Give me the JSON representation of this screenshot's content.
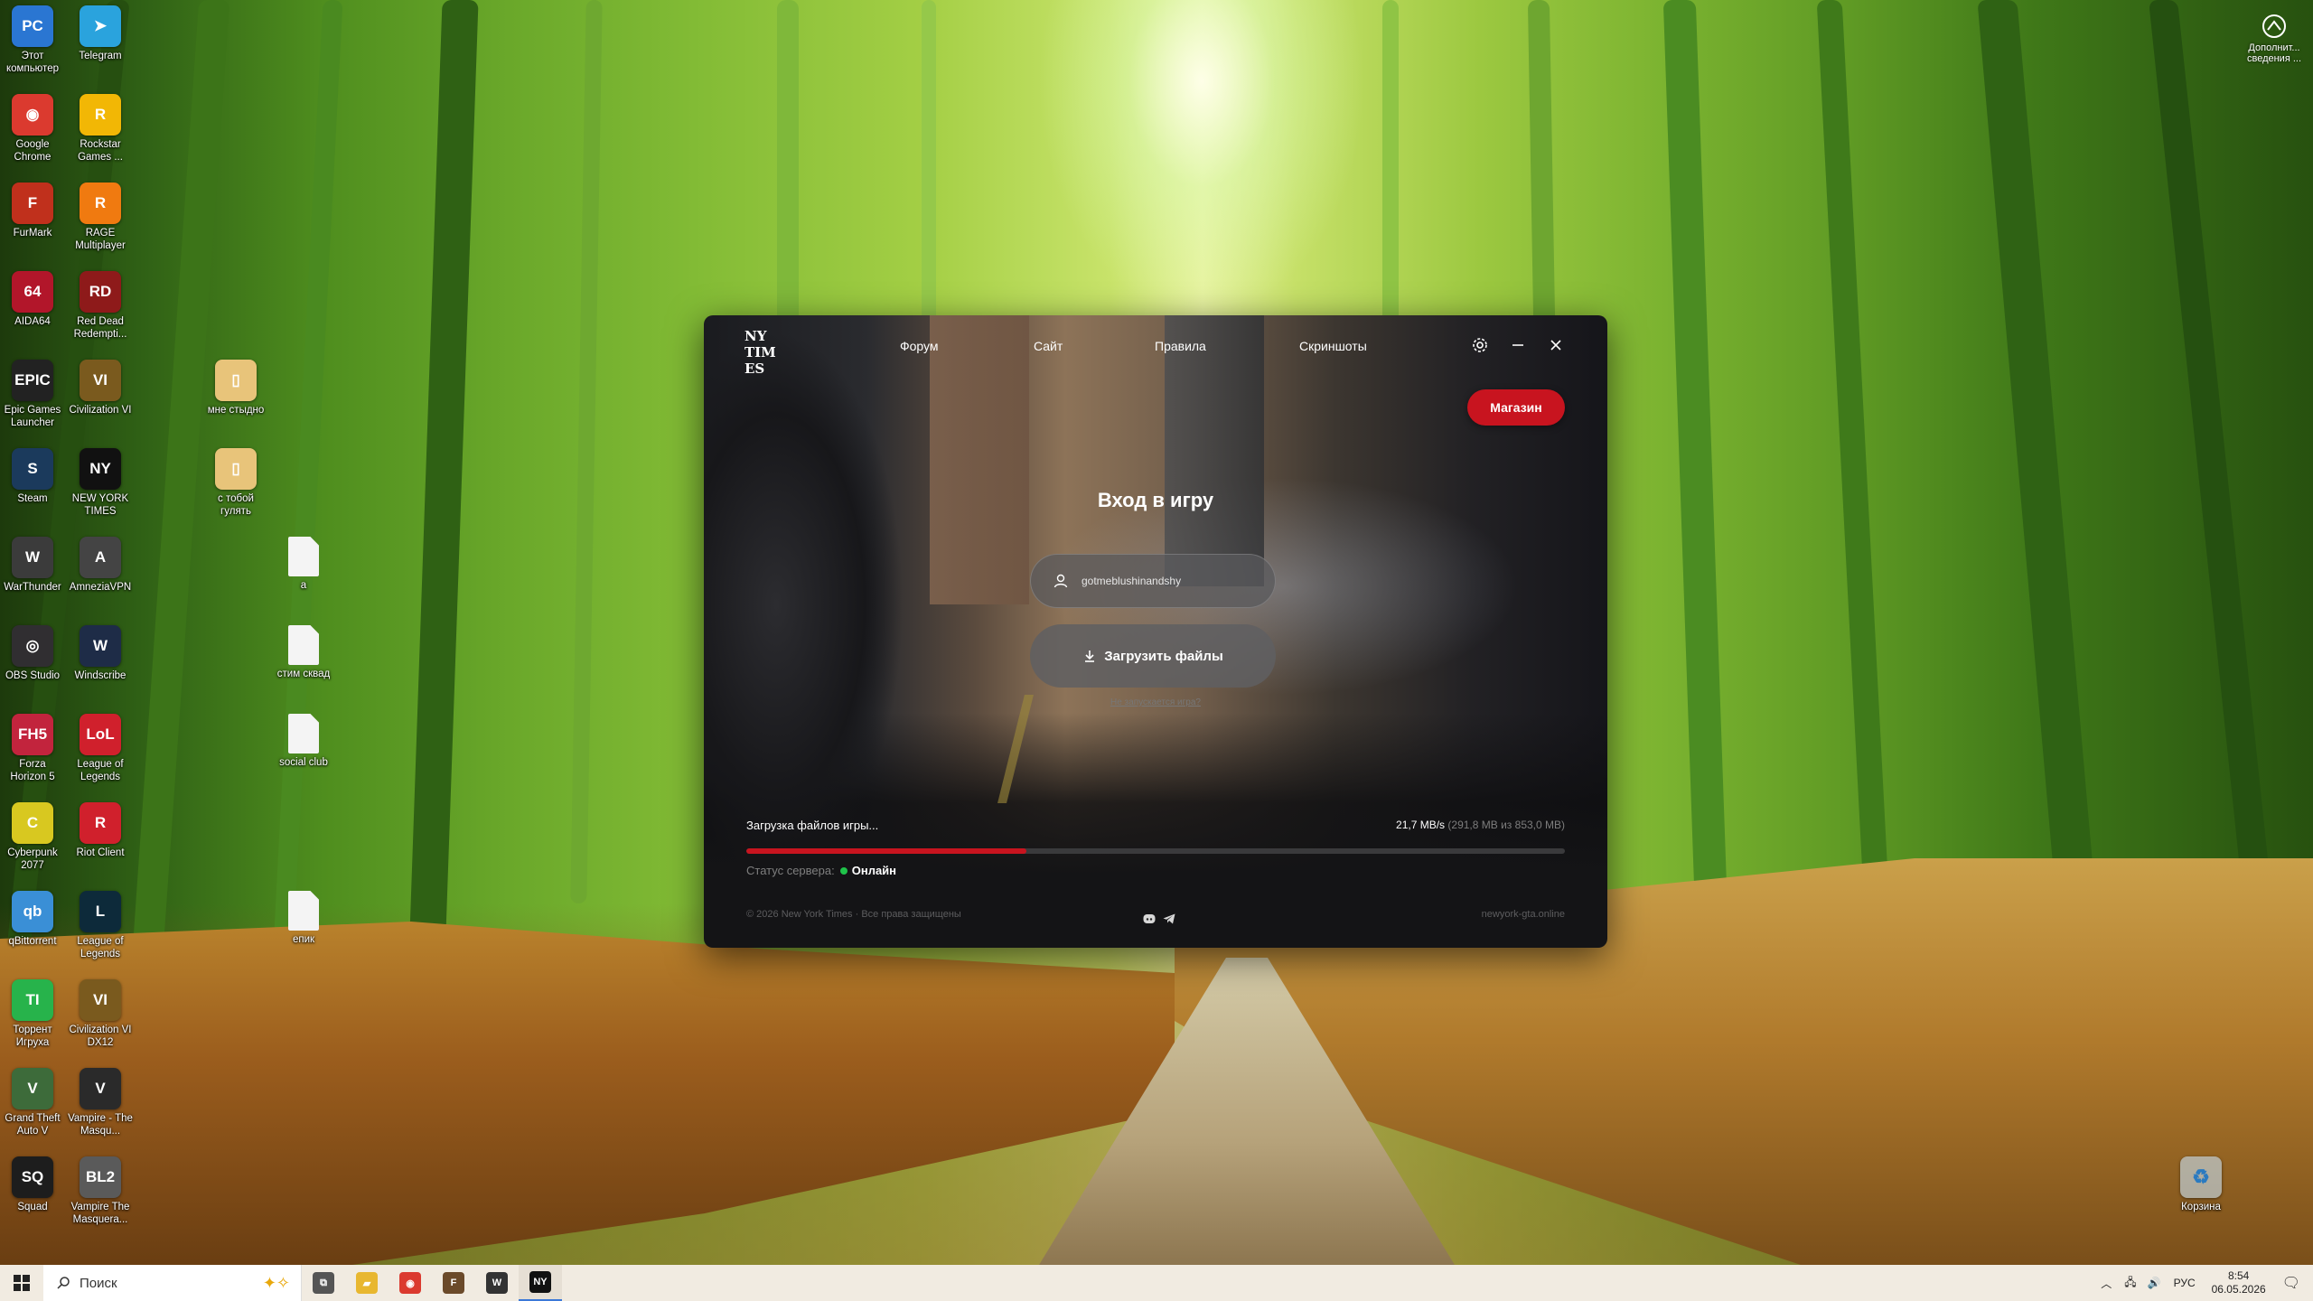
{
  "desktop": {
    "icons_col1": [
      {
        "label": "Этот компьютер",
        "icon": "this-pc-icon",
        "color": "#2a76d2",
        "glyph": "PC"
      },
      {
        "label": "Google Chrome",
        "icon": "chrome-icon",
        "color": "#db3a2f",
        "glyph": "◉"
      },
      {
        "label": "FurMark",
        "icon": "furmark-icon",
        "color": "#c0301c",
        "glyph": "F"
      },
      {
        "label": "AIDA64",
        "icon": "aida64-icon",
        "color": "#b2162a",
        "glyph": "64"
      },
      {
        "label": "Epic Games Launcher",
        "icon": "epic-games-icon",
        "color": "#222222",
        "glyph": "EPIC"
      },
      {
        "label": "Steam",
        "icon": "steam-icon",
        "color": "#1b3a5c",
        "glyph": "S"
      },
      {
        "label": "WarThunder",
        "icon": "warthunder-icon",
        "color": "#3b3b3b",
        "glyph": "W"
      },
      {
        "label": "OBS Studio",
        "icon": "obs-icon",
        "color": "#302e31",
        "glyph": "◎"
      },
      {
        "label": "Forza Horizon 5",
        "icon": "forza-icon",
        "color": "#c2243d",
        "glyph": "FH5"
      },
      {
        "label": "Cyberpunk 2077",
        "icon": "cyberpunk-icon",
        "color": "#d8c820",
        "glyph": "C"
      },
      {
        "label": "qBittorrent",
        "icon": "qbittorrent-icon",
        "color": "#3a8fd6",
        "glyph": "qb"
      },
      {
        "label": "Торрент Игруха",
        "icon": "torrent-igruha-icon",
        "color": "#27b34b",
        "glyph": "TI"
      },
      {
        "label": "Grand Theft Auto V",
        "icon": "gta-icon",
        "color": "#3d6b3a",
        "glyph": "V"
      },
      {
        "label": "Squad",
        "icon": "squad-icon",
        "color": "#1d1d1d",
        "glyph": "SQ"
      }
    ],
    "icons_col2": [
      {
        "label": "Telegram",
        "icon": "telegram-icon",
        "color": "#2aa3dd",
        "glyph": "➤"
      },
      {
        "label": "Rockstar Games ...",
        "icon": "rockstar-icon",
        "color": "#f2b705",
        "glyph": "R"
      },
      {
        "label": "RAGE Multiplayer",
        "icon": "rage-mp-icon",
        "color": "#f07a10",
        "glyph": "R"
      },
      {
        "label": "Red Dead Redempti...",
        "icon": "rdr-icon",
        "color": "#8e1a1a",
        "glyph": "RD"
      },
      {
        "label": "Civilization VI",
        "icon": "civ6-icon",
        "color": "#7a5a1e",
        "glyph": "VI"
      },
      {
        "label": "NEW YORK TIMES",
        "icon": "nyt-launcher-icon",
        "color": "#111111",
        "glyph": "NY"
      },
      {
        "label": "AmneziaVPN",
        "icon": "amnezia-vpn-icon",
        "color": "#444444",
        "glyph": "A"
      },
      {
        "label": "Windscribe",
        "icon": "windscribe-icon",
        "color": "#1e2c47",
        "glyph": "W"
      },
      {
        "label": "League of Legends",
        "icon": "riot-icon",
        "color": "#d0202c",
        "glyph": "LoL"
      },
      {
        "label": "Riot Client",
        "icon": "riot-client-icon",
        "color": "#d0202c",
        "glyph": "R"
      },
      {
        "label": "League of Legends",
        "icon": "lol-icon",
        "color": "#0d2a3a",
        "glyph": "L"
      },
      {
        "label": "Civilization VI DX12",
        "icon": "civ6-dx12-icon",
        "color": "#7a5a1e",
        "glyph": "VI"
      },
      {
        "label": "Vampire - The Masqu...",
        "icon": "vampire-icon",
        "color": "#2a2a2a",
        "glyph": "V"
      },
      {
        "label": "Vampire The Masquera...",
        "icon": "vampire-bloodlines-icon",
        "color": "#5a5a5a",
        "glyph": "BL2"
      }
    ],
    "icons_col3": [
      {
        "label": "мне стыдно",
        "icon": "folder-icon",
        "color": "#e8c47a",
        "glyph": "▯"
      },
      {
        "label": "с тобой гулять",
        "icon": "folder-icon",
        "color": "#e8c47a",
        "glyph": "▯"
      }
    ],
    "icons_col4": [
      {
        "label": "а",
        "icon": "text-file-icon"
      },
      {
        "label": "стим сквад",
        "icon": "text-file-icon"
      },
      {
        "label": "social club",
        "icon": "text-file-icon"
      },
      {
        "label": "епик",
        "icon": "text-file-icon"
      }
    ],
    "recycle_bin": "Корзина",
    "corner_widget": "Дополнит... сведения ..."
  },
  "launcher": {
    "logo": "NY TIMES",
    "nav": [
      "Форум",
      "Сайт",
      "Правила",
      "Скриншоты"
    ],
    "shop_button": "Магазин",
    "login_title": "Вход в игру",
    "username": "gotmeblushinandshy",
    "download_button": "Загрузить файлы",
    "not_launching_link": "Не запускается игра?",
    "download_status": "Загрузка файлов игры...",
    "speed": "21,7 MB/s",
    "size_progress": "(291,8 MB из 853,0 MB)",
    "progress_fraction": 0.342,
    "server_status_label": "Статус сервера:",
    "server_status_value": "Онлайн",
    "copyright": "© 2026 New York Times · Все права защищены",
    "site_link": "newyork-gta.online",
    "accent_color": "#c8141f",
    "online_color": "#1fc34a"
  },
  "taskbar": {
    "search_placeholder": "Поиск",
    "pinned": [
      {
        "name": "task-view",
        "glyph": "⧉",
        "color": "#555555"
      },
      {
        "name": "file-explorer",
        "glyph": "▰",
        "color": "#e8b730"
      },
      {
        "name": "chrome",
        "glyph": "◉",
        "color": "#db3a2f"
      },
      {
        "name": "furmark",
        "glyph": "F",
        "color": "#6b4a2a"
      },
      {
        "name": "warthunder",
        "glyph": "W",
        "color": "#333333"
      },
      {
        "name": "nyt-launcher",
        "glyph": "NY",
        "color": "#111111"
      }
    ],
    "language": "РУС",
    "time": "8:54",
    "date": "06.05.2026"
  }
}
